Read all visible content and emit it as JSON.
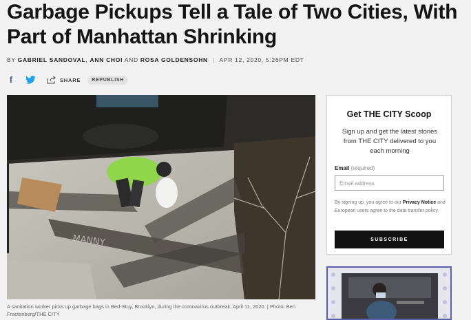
{
  "article": {
    "headline": "Garbage Pickups Tell a Tale of Two Cities, With Part of Manhattan Shrinking",
    "byline": {
      "prefix": "BY",
      "author1": "GABRIEL SANDOVAL",
      "sep1": ",",
      "author2": "ANN CHOI",
      "conj": "AND",
      "author3": "ROSA GOLDENSOHN",
      "date": "APR 12, 2020, 5:26PM EDT"
    },
    "share": {
      "facebook_glyph": "f",
      "share_label": "SHARE",
      "republish_label": "REPUBLISH"
    },
    "photo": {
      "icon": "photo-of-sanitation-worker"
    },
    "caption": "A sanitation worker picks up garbage bags in Bed-Stuy, Brooklyn, during the coronavirus outbreak, April 11, 2020. | Photo: Ben Fractenberg/THE CITY"
  },
  "signup": {
    "title": "Get THE CITY Scoop",
    "description": "Sign up and get the latest stories from THE CITY delivered to you each morning",
    "email_label": "Email",
    "email_required": "(required)",
    "email_placeholder": "Email address",
    "legal_pre": "By signing up, you agree to our",
    "legal_link": "Privacy Notice",
    "legal_post": "and European users agree to the data transfer policy.",
    "subscribe_label": "SUBSCRIBE"
  },
  "colors": {
    "facebook": "#3b5998",
    "twitter": "#1da1f2",
    "promo_border": "#5b5ea8",
    "worker_vest": "#8fd64a"
  }
}
